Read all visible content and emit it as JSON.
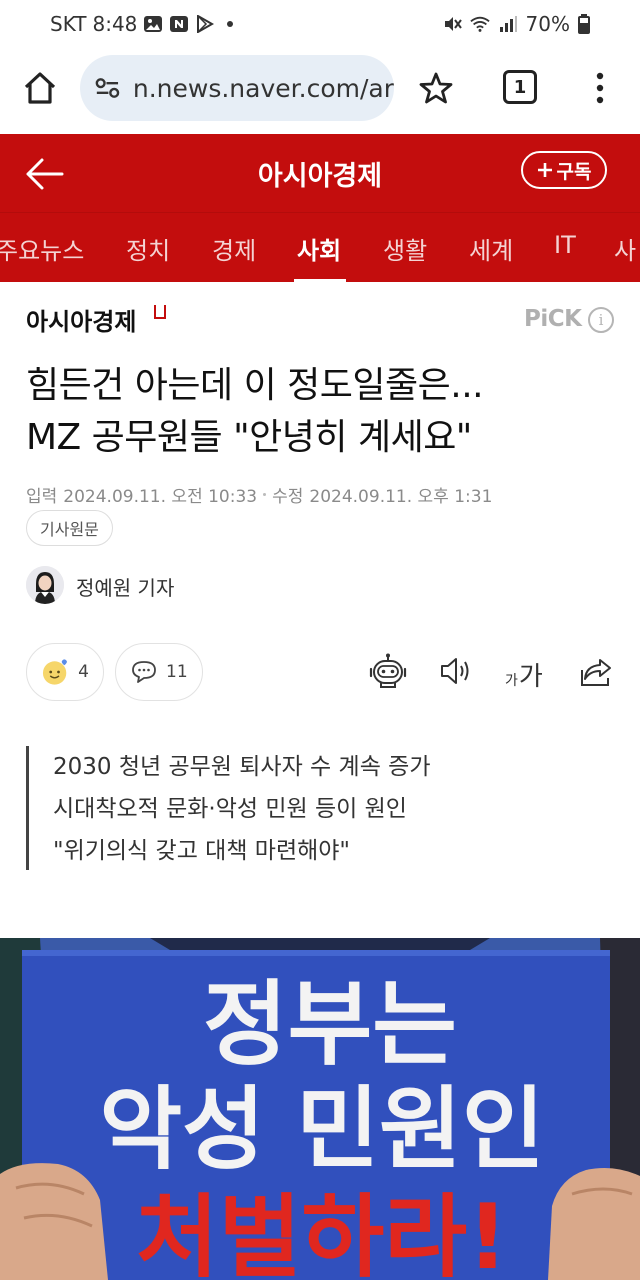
{
  "status_bar": {
    "carrier": "SKT",
    "time": "8:48",
    "battery": "70%"
  },
  "browser": {
    "url": "n.news.naver.com/ar",
    "tab_count": "1"
  },
  "header": {
    "title": "아시아경제",
    "subscribe_label": "구독"
  },
  "categories": [
    {
      "label": "주요뉴스"
    },
    {
      "label": "정치"
    },
    {
      "label": "경제"
    },
    {
      "label": "사회"
    },
    {
      "label": "생활"
    },
    {
      "label": "세계"
    },
    {
      "label": "IT"
    },
    {
      "label": "사"
    }
  ],
  "active_category": "사회",
  "article": {
    "press": "아시아경제",
    "pick_label": "PiCK",
    "headline_line1": "힘든건 아는데 이 정도일줄은...",
    "headline_line2": "MZ 공무원들 \"안녕히 계세요\"",
    "input_label": "입력",
    "input_date": "2024.09.11. 오전 10:33",
    "modified_label": "수정",
    "modified_date": "2024.09.11. 오후 1:31",
    "original_label": "기사원문",
    "reporter": "정예원 기자",
    "reaction_count": "4",
    "comment_count": "11",
    "font_size_small": "가",
    "font_size_large": "가",
    "summary": [
      "2030 청년 공무원 퇴사자 수 계속 증가",
      "시대착오적 문화·악성 민원 등이 원인",
      "\"위기의식 갖고 대책 마련해야\""
    ]
  },
  "photo": {
    "sign_line1": "정부는",
    "sign_line2": "악성 민원인",
    "sign_line3": "처벌하라!"
  },
  "colors": {
    "brand_red": "#c30d0d",
    "url_bar": "#e7eef6",
    "sign_blue": "#2e4cb8",
    "sign_text_red": "#e0271f"
  }
}
